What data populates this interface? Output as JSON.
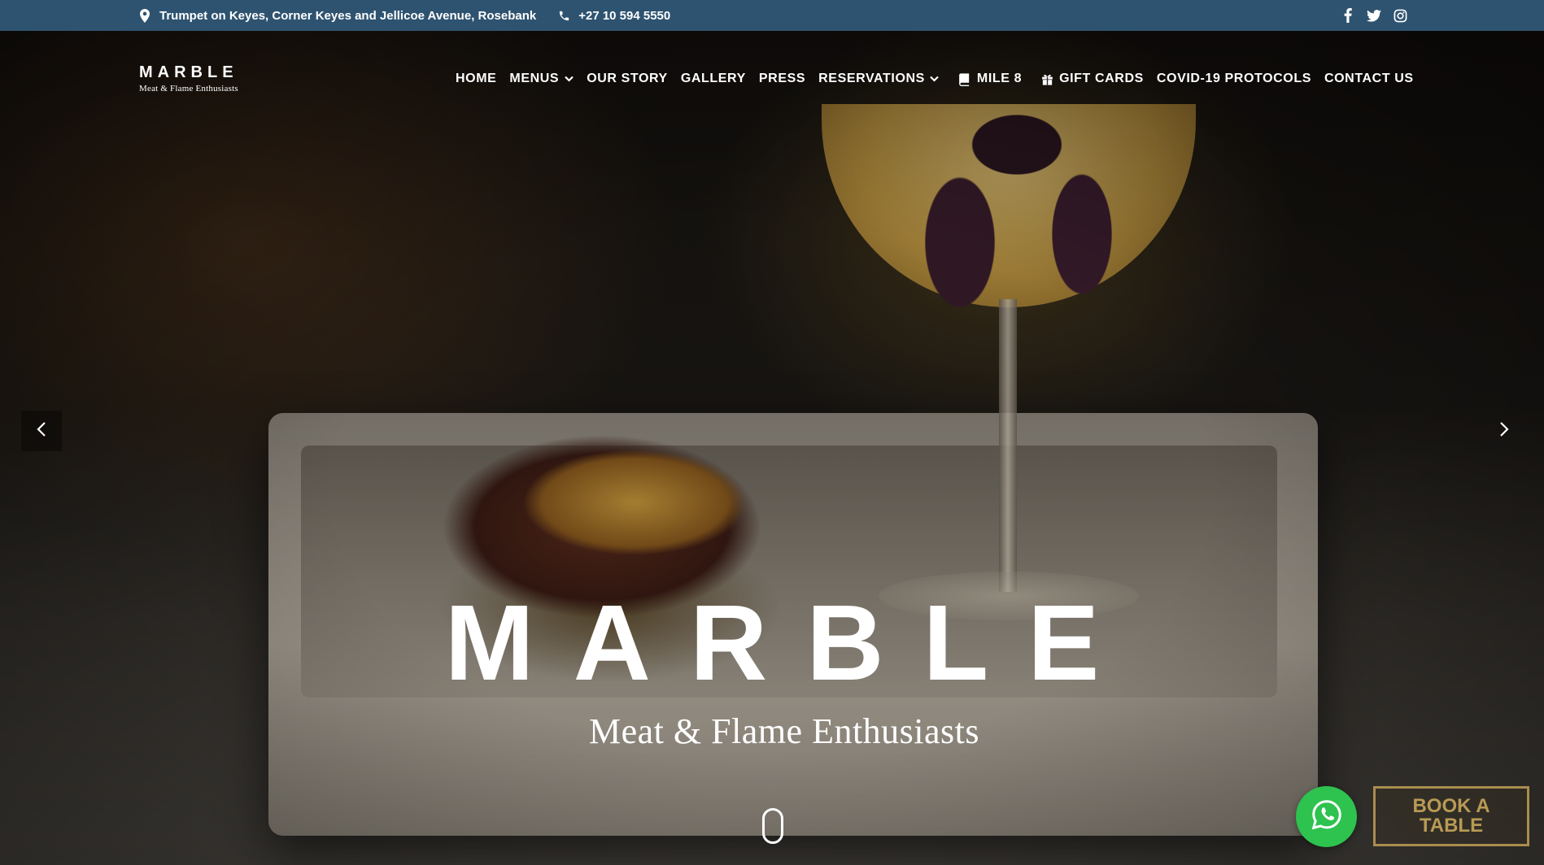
{
  "topbar": {
    "address": "Trumpet on Keyes, Corner Keyes and Jellicoe Avenue, Rosebank",
    "phone": "+27 10 594 5550",
    "icons": {
      "location": "map-pin-icon",
      "phone": "phone-icon"
    },
    "social": [
      "facebook-icon",
      "twitter-icon",
      "instagram-icon"
    ],
    "background": "#2e5370"
  },
  "logo": {
    "word": "MARBLE",
    "tagline": "Meat & Flame Enthusiasts"
  },
  "nav": {
    "home": "HOME",
    "menus": "MENUS",
    "our_story": "OUR STORY",
    "gallery": "GALLERY",
    "press": "PRESS",
    "reservations": "RESERVATIONS",
    "mile8": "MILE 8",
    "gift_cards": "GIFT CARDS",
    "covid": "COVID-19 PROTOCOLS",
    "contact": "CONTACT US"
  },
  "hero": {
    "title": "MARBLE",
    "subtitle": "Meat & Flame Enthusiasts"
  },
  "cta": {
    "book_table": "BOOK A TABLE",
    "whatsapp_color": "#2ec24f",
    "book_border_color": "#a98d4e"
  }
}
